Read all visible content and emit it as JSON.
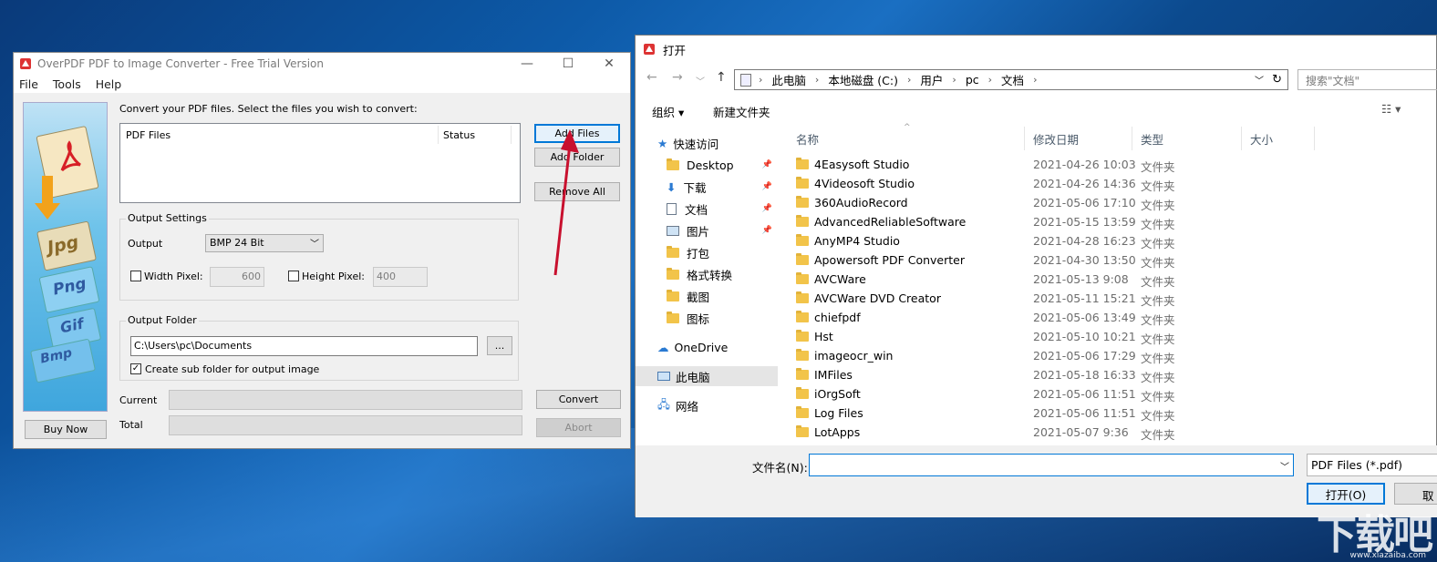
{
  "app": {
    "title": "OverPDF PDF to Image Converter - Free Trial Version",
    "menu": [
      "File",
      "Tools",
      "Help"
    ],
    "instruction": "Convert your PDF files. Select the files you wish to convert:",
    "list_headers": {
      "files": "PDF Files",
      "status": "Status"
    },
    "buttons": {
      "add_files": "Add Files",
      "add_folder": "Add Folder",
      "remove_all": "Remove All",
      "convert": "Convert",
      "abort": "Abort",
      "buy_now": "Buy Now",
      "browse": "..."
    },
    "output_settings": {
      "title": "Output Settings",
      "output_label": "Output",
      "output_value": "BMP 24 Bit",
      "width_label": "Width Pixel:",
      "width_value": "600",
      "height_label": "Height Pixel:",
      "height_value": "400"
    },
    "output_folder": {
      "title": "Output Folder",
      "path": "C:\\Users\\pc\\Documents",
      "subfolder_label": "Create sub folder for output image",
      "subfolder_checked": "✓"
    },
    "progress": {
      "current": "Current",
      "total": "Total"
    },
    "side_labels": [
      "Jpg",
      "Png",
      "Gif",
      "Bmp"
    ]
  },
  "dialog": {
    "title": "打开",
    "breadcrumb": [
      "此电脑",
      "本地磁盘 (C:)",
      "用户",
      "pc",
      "文档"
    ],
    "search_placeholder": "搜索\"文档\"",
    "toolbar": {
      "organize": "组织 ▾",
      "new_folder": "新建文件夹"
    },
    "tree": {
      "quick_access": "快速访问",
      "items": [
        "Desktop",
        "下载",
        "文档",
        "图片",
        "打包",
        "格式转换",
        "截图",
        "图标"
      ],
      "onedrive": "OneDrive",
      "this_pc": "此电脑",
      "network": "网络"
    },
    "columns": {
      "name": "名称",
      "date": "修改日期",
      "type": "类型",
      "size": "大小"
    },
    "files": [
      {
        "name": "4Easysoft Studio",
        "date": "2021-04-26 10:03",
        "type": "文件夹"
      },
      {
        "name": "4Videosoft Studio",
        "date": "2021-04-26 14:36",
        "type": "文件夹"
      },
      {
        "name": "360AudioRecord",
        "date": "2021-05-06 17:10",
        "type": "文件夹"
      },
      {
        "name": "AdvancedReliableSoftware",
        "date": "2021-05-15 13:59",
        "type": "文件夹"
      },
      {
        "name": "AnyMP4 Studio",
        "date": "2021-04-28 16:23",
        "type": "文件夹"
      },
      {
        "name": "Apowersoft PDF Converter",
        "date": "2021-04-30 13:50",
        "type": "文件夹"
      },
      {
        "name": "AVCWare",
        "date": "2021-05-13 9:08",
        "type": "文件夹"
      },
      {
        "name": "AVCWare DVD Creator",
        "date": "2021-05-11 15:21",
        "type": "文件夹"
      },
      {
        "name": "chiefpdf",
        "date": "2021-05-06 13:49",
        "type": "文件夹"
      },
      {
        "name": "Hst",
        "date": "2021-05-10 10:21",
        "type": "文件夹"
      },
      {
        "name": "imageocr_win",
        "date": "2021-05-06 17:29",
        "type": "文件夹"
      },
      {
        "name": "IMFiles",
        "date": "2021-05-18 16:33",
        "type": "文件夹"
      },
      {
        "name": "iOrgSoft",
        "date": "2021-05-06 11:51",
        "type": "文件夹"
      },
      {
        "name": "Log Files",
        "date": "2021-05-06 11:51",
        "type": "文件夹"
      },
      {
        "name": "LotApps",
        "date": "2021-05-07 9:36",
        "type": "文件夹"
      }
    ],
    "filename_label": "文件名(N):",
    "filter": "PDF Files (*.pdf)",
    "open_button": "打开(O)",
    "cancel_button": "取"
  },
  "watermark": {
    "text": "下载吧",
    "url": "www.xiazaiba.com"
  },
  "colors": {
    "accent": "#0078d7",
    "arrow": "#c8102e"
  }
}
